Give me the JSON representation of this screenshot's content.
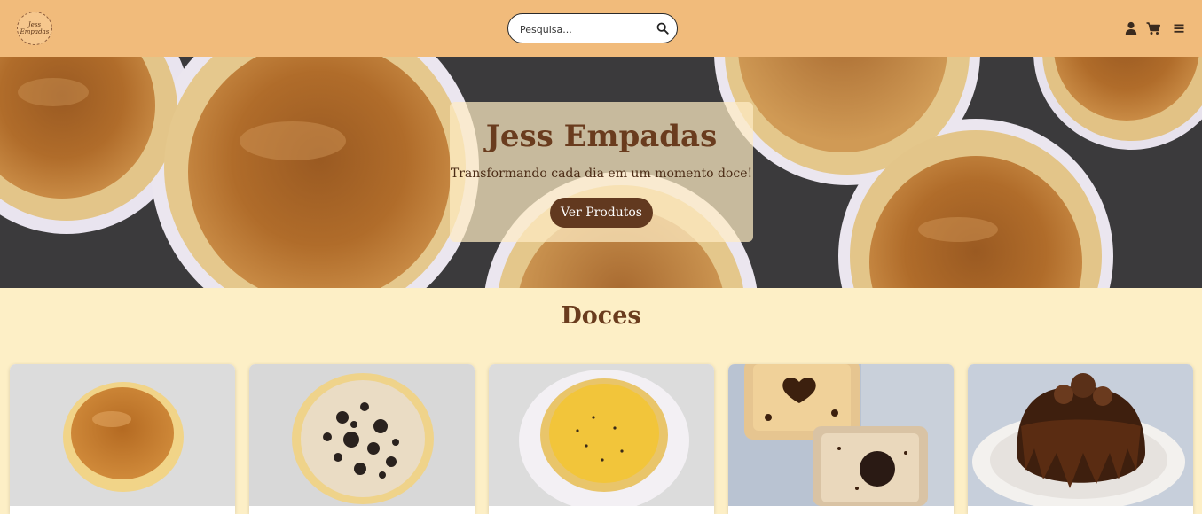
{
  "header": {
    "logo_line1": "Jess",
    "logo_line2": "Empadas",
    "search_placeholder": "Pesquisa...",
    "icons": [
      "search-icon",
      "user-icon",
      "cart-icon",
      "menu-icon"
    ]
  },
  "hero": {
    "title": "Jess Empadas",
    "subtitle": "Transformando cada dia em um momento doce!",
    "button_label": "Ver Produtos"
  },
  "section": {
    "title": "Doces"
  },
  "products": [
    {
      "image": "empada-doce-de-leite"
    },
    {
      "image": "empada-oreo"
    },
    {
      "image": "empada-maracuja"
    },
    {
      "image": "doce-pote-chocolate"
    },
    {
      "image": "bolo-chocolate"
    }
  ],
  "colors": {
    "header_bg": "#f1bb7b",
    "page_bg": "#fdefc6",
    "brand_brown": "#62391f",
    "title_brown": "#6a3c1e"
  }
}
